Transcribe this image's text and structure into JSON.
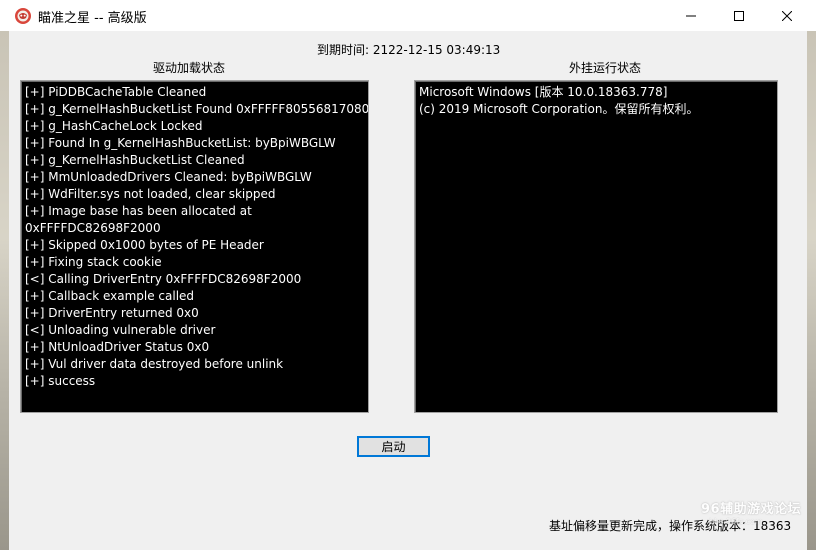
{
  "window": {
    "title": "瞄准之星 -- 高级版",
    "icon": "app-star-icon"
  },
  "controls": {
    "minimize_icon": "minimize-icon",
    "maximize_icon": "maximize-icon",
    "close_icon": "close-icon"
  },
  "header": {
    "expiry": "到期时间: 2122-12-15 03:49:13"
  },
  "driver_panel": {
    "label": "驱动加载状态",
    "lines": [
      "[+] PiDDBCacheTable Cleaned",
      "[+] g_KernelHashBucketList Found 0xFFFFF80556817080",
      "[+] g_HashCacheLock Locked",
      "[+] Found In g_KernelHashBucketList: byBpiWBGLW",
      "[+] g_KernelHashBucketList Cleaned",
      "[+] MmUnloadedDrivers Cleaned: byBpiWBGLW",
      "[+] WdFilter.sys not loaded, clear skipped",
      "[+] Image base has been allocated at",
      "0xFFFFDC82698F2000",
      "[+] Skipped 0x1000 bytes of PE Header",
      "[+] Fixing stack cookie",
      "[<] Calling DriverEntry 0xFFFFDC82698F2000",
      "[+] Callback example called",
      "[+] DriverEntry returned 0x0",
      "[<] Unloading vulnerable driver",
      "[+] NtUnloadDriver Status 0x0",
      "[+] Vul driver data destroyed before unlink",
      "[+] success"
    ]
  },
  "cheat_panel": {
    "label": "外挂运行状态",
    "lines": [
      "Microsoft Windows [版本 10.0.18363.778]",
      "(c) 2019 Microsoft Corporation。保留所有权利。"
    ]
  },
  "start_button": {
    "label": "启动"
  },
  "status": {
    "text": "基址偏移量更新完成，操作系统版本：18363"
  },
  "watermark": {
    "text": "96辅助游戏论坛",
    "sub": "bbs.96fz.com"
  },
  "colors": {
    "console_bg": "#000000",
    "console_fg": "#ffffff",
    "client_bg": "#f0f0f0",
    "button_accent": "#0078d7"
  }
}
